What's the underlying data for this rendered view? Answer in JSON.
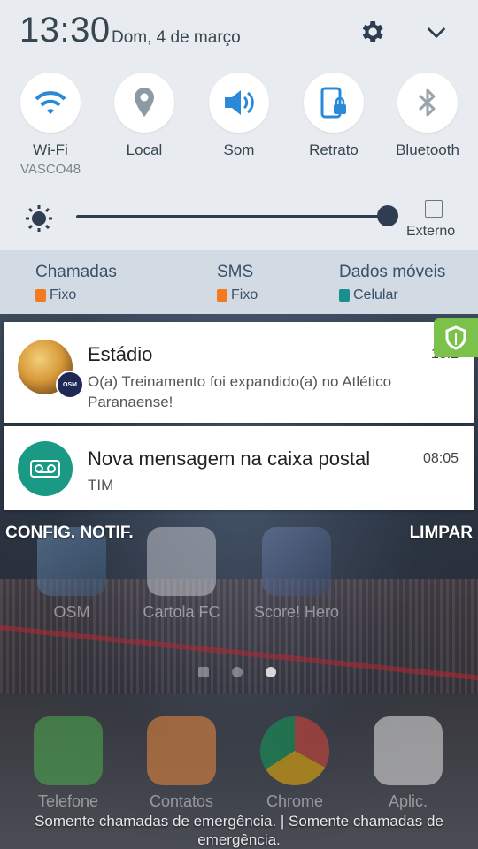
{
  "header": {
    "time": "13:30",
    "date": "Dom, 4 de março",
    "settings_icon": "gear-icon",
    "expand_icon": "chevron-down-icon"
  },
  "toggles": [
    {
      "label": "Wi-Fi",
      "sub": "VASCO48",
      "icon": "wifi-icon",
      "active": true
    },
    {
      "label": "Local",
      "sub": "",
      "icon": "location-pin-icon",
      "active": false
    },
    {
      "label": "Som",
      "sub": "",
      "icon": "speaker-icon",
      "active": true
    },
    {
      "label": "Retrato",
      "sub": "",
      "icon": "portrait-lock-icon",
      "active": true
    },
    {
      "label": "Bluetooth",
      "sub": "",
      "icon": "bluetooth-icon",
      "active": false
    }
  ],
  "brightness": {
    "level": 0.99,
    "external_label": "Externo",
    "external_checked": false
  },
  "sim": [
    {
      "title": "Chamadas",
      "sim": "Fixo",
      "color": "#f47a20"
    },
    {
      "title": "SMS",
      "sim": "Fixo",
      "color": "#f47a20"
    },
    {
      "title": "Dados móveis",
      "sim": "Celular",
      "color": "#1a8f8f"
    }
  ],
  "notifications": [
    {
      "app": "OSM",
      "title": "Estádio",
      "time": "13:2",
      "body": "O(a) Treinamento foi expandido(a) no Atlético Paranaense!"
    },
    {
      "app": "voicemail",
      "title": "Nova mensagem na caixa postal",
      "time": "08:05",
      "body": "TIM"
    }
  ],
  "actions": {
    "settings": "CONFIG. NOTIF.",
    "clear": "LIMPAR"
  },
  "home_apps": [
    "OSM",
    "Cartola FC",
    "Score! Hero"
  ],
  "dock_apps": [
    "Telefone",
    "Contatos",
    "Chrome",
    "Aplic."
  ],
  "footer": "Somente chamadas de emergência. | Somente chamadas de emergência.",
  "colors": {
    "accent": "#2f3d52",
    "panel": "#e8ecf0",
    "sim_row": "#d2dbe4",
    "shield": "#7cc24a"
  }
}
